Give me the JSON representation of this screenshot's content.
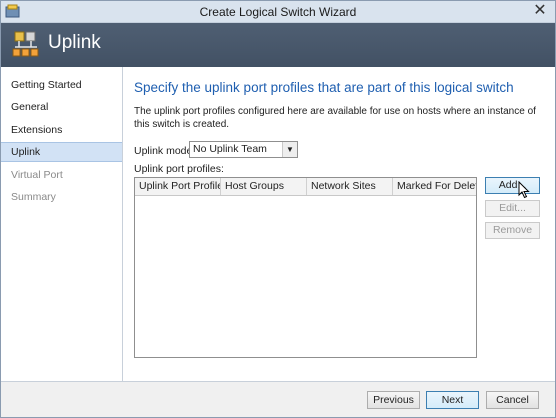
{
  "window": {
    "title": "Create Logical Switch Wizard",
    "close_glyph": "✕"
  },
  "banner": {
    "title": "Uplink",
    "icon": "uplink-network-icon"
  },
  "sidebar": {
    "items": [
      {
        "label": "Getting Started",
        "state": "normal"
      },
      {
        "label": "General",
        "state": "normal"
      },
      {
        "label": "Extensions",
        "state": "normal"
      },
      {
        "label": "Uplink",
        "state": "selected"
      },
      {
        "label": "Virtual Port",
        "state": "disabled"
      },
      {
        "label": "Summary",
        "state": "disabled"
      }
    ]
  },
  "main": {
    "heading": "Specify the uplink port profiles that are part of this logical switch",
    "description": "The uplink port profiles configured here are available for use on hosts where an instance of this switch is created.",
    "uplink_mode": {
      "label": "Uplink mode:",
      "selected": "No Uplink Team"
    },
    "profiles_label": "Uplink port profiles:",
    "table": {
      "columns": [
        "Uplink Port Profile",
        "Host Groups",
        "Network Sites",
        "Marked For Deleti..."
      ],
      "rows": []
    },
    "buttons": {
      "add": "Add...",
      "edit": "Edit...",
      "remove": "Remove"
    }
  },
  "footer": {
    "previous": "Previous",
    "next": "Next",
    "cancel": "Cancel"
  },
  "colors": {
    "accent_heading": "#1f5fb0",
    "banner": "#4a596c",
    "selected_nav": "#d2e2f5"
  }
}
